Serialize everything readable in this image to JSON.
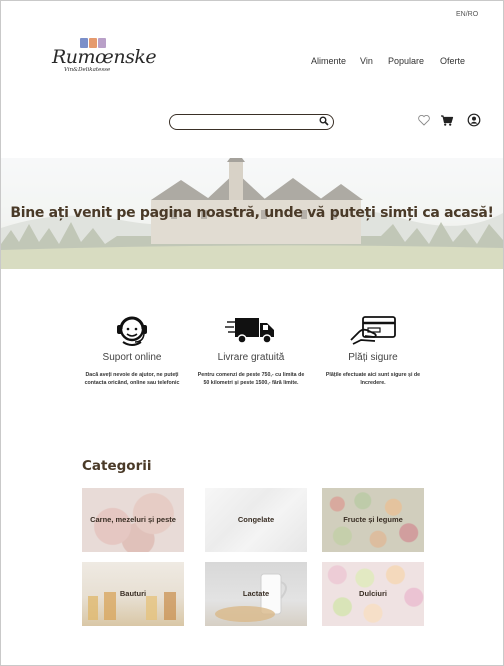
{
  "header": {
    "language": "EN/RO",
    "logo": {
      "name": "Rumœnske",
      "tagline": "Vin&Delikatesse",
      "swatch_colors": [
        "#7b8fc9",
        "#e59a6e",
        "#b9a0c8"
      ]
    },
    "nav": [
      "Alimente",
      "Vin",
      "Populare",
      "Oferte"
    ],
    "search": {
      "placeholder": "",
      "value": ""
    },
    "icons": [
      "heart-icon",
      "cart-icon",
      "user-icon"
    ]
  },
  "hero": {
    "headline": "Bine ați venit pe pagina noastră, unde vă puteți simți ca acasă!"
  },
  "features": [
    {
      "icon": "headset-icon",
      "title": "Suport online",
      "description": "Dacă aveți nevoie de ajutor, ne puteți contacta oricând, online sau telefonic"
    },
    {
      "icon": "truck-icon",
      "title": "Livrare gratuită",
      "description": "Pentru comenzi de peste 750,- cu limita de 50 kilometri și peste 1500,- fără limite."
    },
    {
      "icon": "card-payment-icon",
      "title": "Plăți sigure",
      "description": "Plățile efectuate aici sunt sigure și de încredere."
    }
  ],
  "categories": {
    "title": "Categorii",
    "items": [
      {
        "label": "Carne, mezeluri și peste"
      },
      {
        "label": "Congelate"
      },
      {
        "label": "Fructe și legume"
      },
      {
        "label": "Bauturi"
      },
      {
        "label": "Lactate"
      },
      {
        "label": "Dulciuri"
      }
    ]
  },
  "colors": {
    "accent_text": "#4a3a28",
    "border": "#3a3027"
  }
}
